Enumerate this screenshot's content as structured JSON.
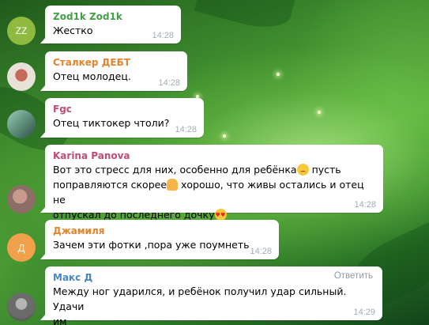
{
  "chat": {
    "messages": [
      {
        "sender": "Zod1k Zod1k",
        "sender_color": "#43a047",
        "avatar": "ZZ",
        "avatar_color": "#8fb93f",
        "text": "Жестко",
        "time": "14:28"
      },
      {
        "sender": "Сталкер ДЕБТ",
        "sender_color": "#e2852c",
        "avatar": "",
        "avatar_color": "#d9d1c8",
        "text": "Отец молодец.",
        "time": "14:28"
      },
      {
        "sender": "Fgc",
        "sender_color": "#c04c74",
        "avatar": "",
        "avatar_color": "#6e9c8a",
        "text": "Отец тиктокер чтоли?",
        "time": "14:28"
      },
      {
        "sender": "Karina Panova",
        "sender_color": "#c04c74",
        "avatar": "",
        "avatar_color": "#b08e86",
        "text_line1": "Вот это стресс для них, особенно для ребёнка",
        "text_line1b": "пусть",
        "text_line2": "поправляются скорее",
        "text_line2b": "хорошо, что живы остались и отец не",
        "text_line3": "отпускал до последнего дочку",
        "emojis": [
          "sad-face",
          "praying-hands",
          "heart-eyes"
        ],
        "time": "14:28"
      },
      {
        "sender": "Джамиля",
        "sender_color": "#e2852c",
        "avatar": "Д",
        "avatar_color": "#f1a04c",
        "text": "Зачем эти фотки ,пора уже поумнеть",
        "time": "14:28"
      },
      {
        "sender": "Макс Д",
        "sender_color": "#4a87c2",
        "avatar": "",
        "avatar_color": "#808080",
        "text_line1": "Между ног ударился, и ребёнок получил удар сильный. Удачи",
        "text_line2": "им",
        "reply_label": "Ответить",
        "time": "14:29"
      }
    ]
  }
}
